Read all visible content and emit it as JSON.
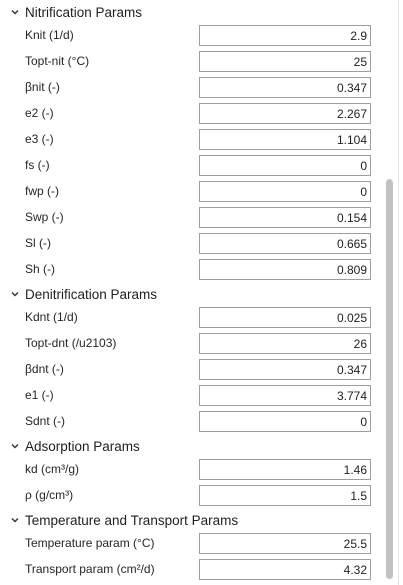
{
  "sections": [
    {
      "title": "Nitrification Params",
      "params": [
        {
          "label": "Knit (1/d)",
          "value": "2.9"
        },
        {
          "label": "Topt-nit (°C)",
          "value": "25"
        },
        {
          "label": "βnit (-)",
          "value": "0.347"
        },
        {
          "label": "e2 (-)",
          "value": "2.267"
        },
        {
          "label": "e3 (-)",
          "value": "1.104"
        },
        {
          "label": "fs (-)",
          "value": "0"
        },
        {
          "label": "fwp (-)",
          "value": "0"
        },
        {
          "label": "Swp (-)",
          "value": "0.154"
        },
        {
          "label": "Sl (-)",
          "value": "0.665"
        },
        {
          "label": "Sh (-)",
          "value": "0.809"
        }
      ]
    },
    {
      "title": "Denitrification Params",
      "params": [
        {
          "label": "Kdnt (1/d)",
          "value": "0.025"
        },
        {
          "label": "Topt-dnt (/u2103)",
          "value": "26"
        },
        {
          "label": "βdnt (-)",
          "value": "0.347"
        },
        {
          "label": "e1 (-)",
          "value": "3.774"
        },
        {
          "label": "Sdnt (-)",
          "value": "0"
        }
      ]
    },
    {
      "title": "Adsorption Params",
      "params": [
        {
          "label": "kd (cm³/g)",
          "value": "1.46"
        },
        {
          "label": "ρ (g/cm³)",
          "value": "1.5"
        }
      ]
    },
    {
      "title": "Temperature and Transport Params",
      "params": [
        {
          "label": "Temperature param (°C)",
          "value": "25.5"
        },
        {
          "label": "Transport param (cm²/d)",
          "value": "4.32"
        }
      ]
    }
  ]
}
